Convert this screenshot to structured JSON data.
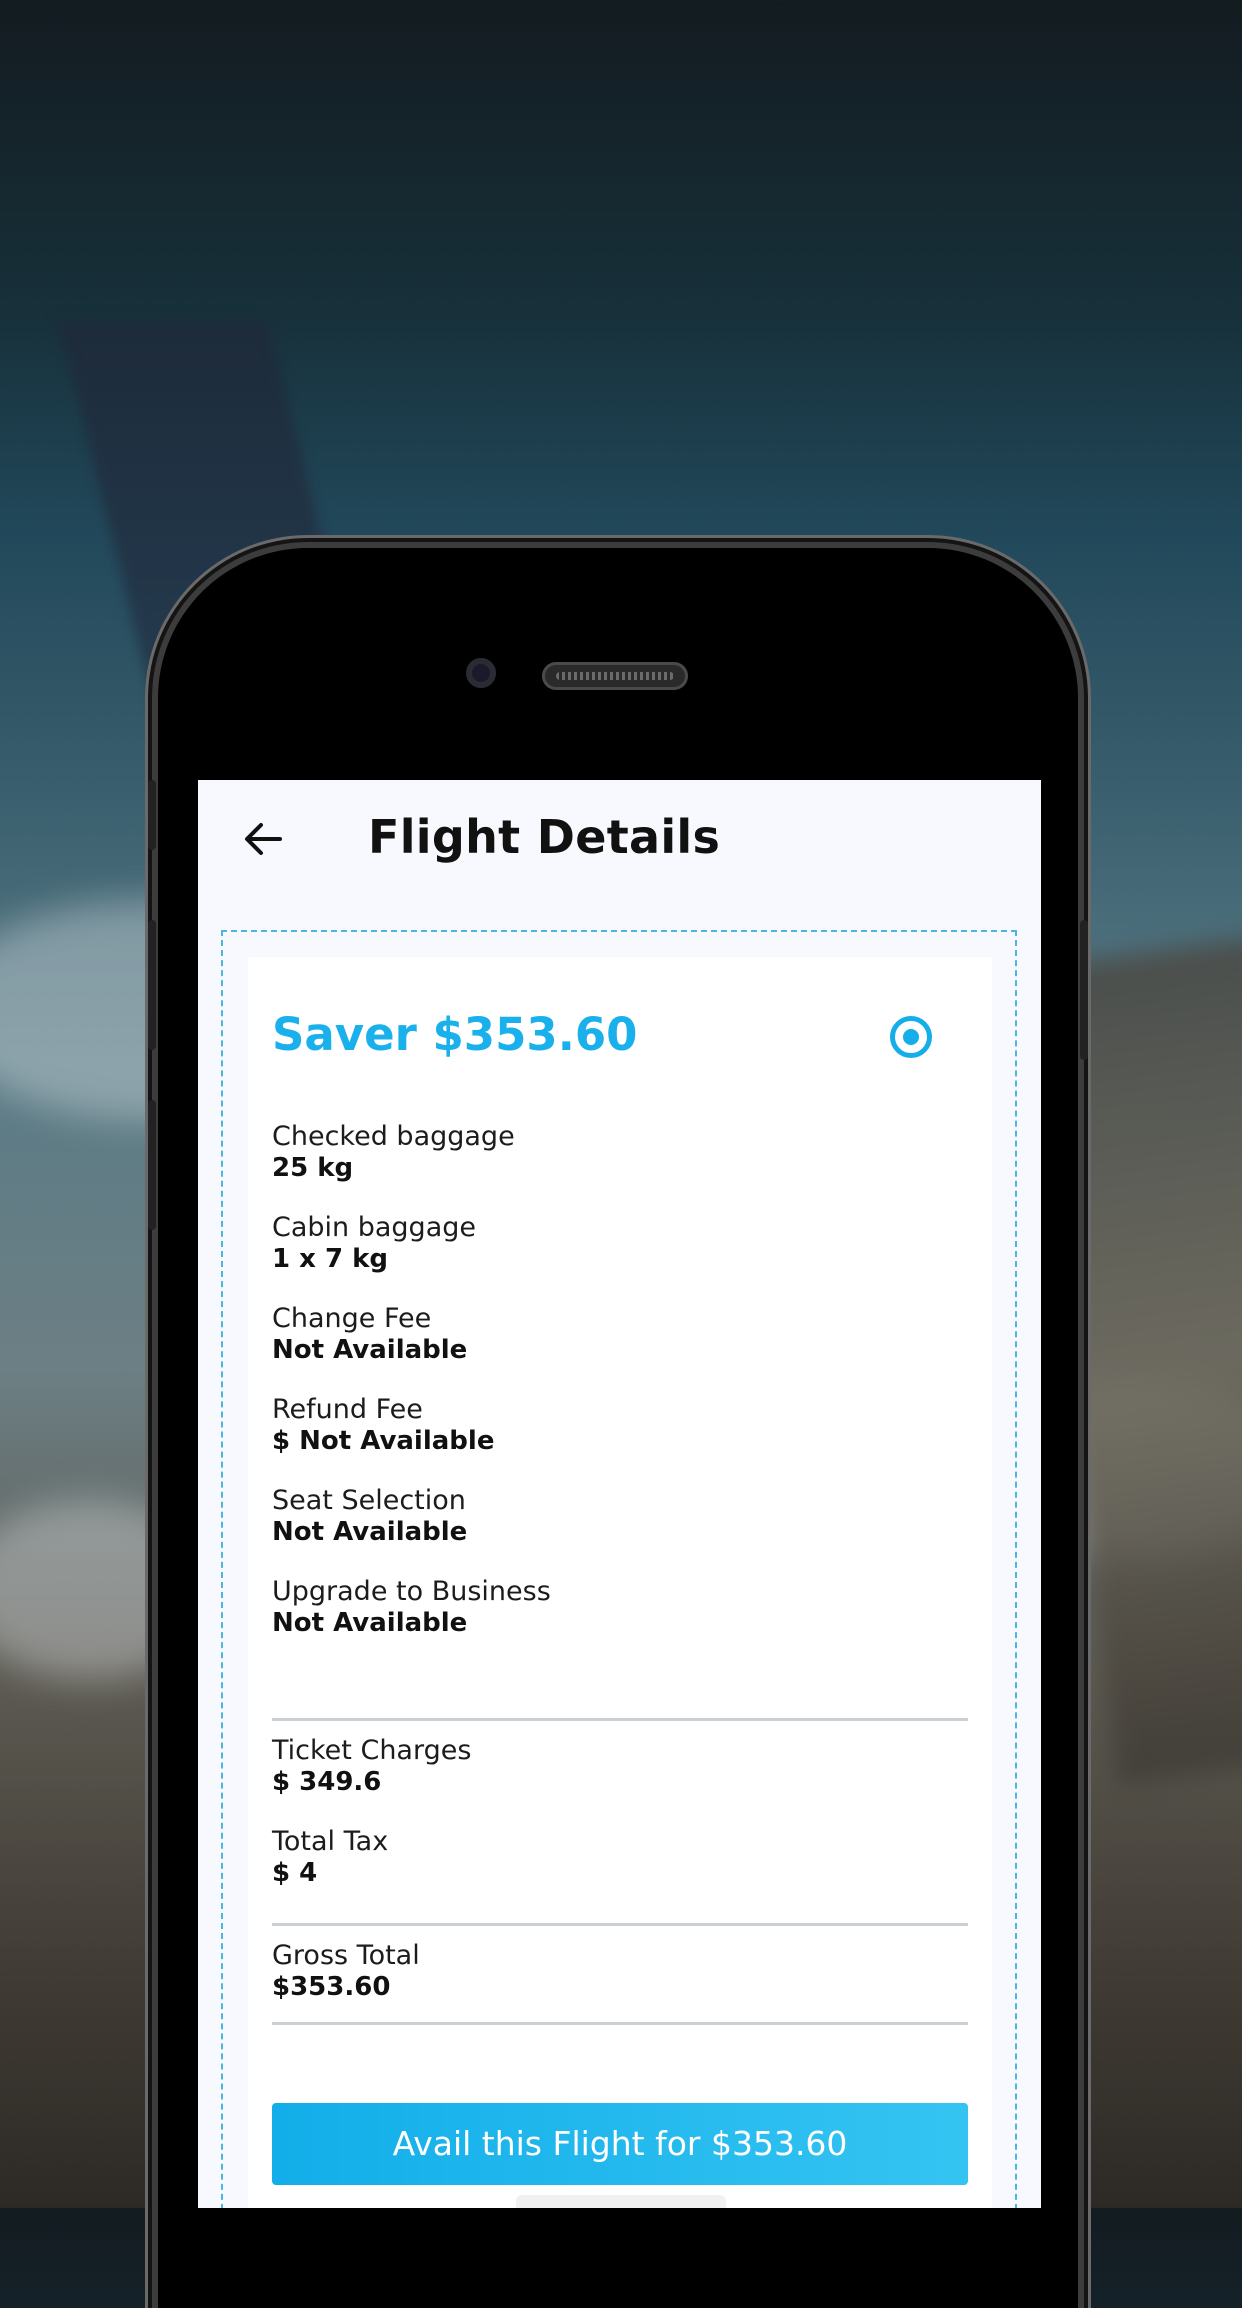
{
  "header": {
    "title": "Flight Details"
  },
  "fare": {
    "title": "Saver $353.60",
    "selected": true,
    "accent_color": "#1ab0ec"
  },
  "details": [
    {
      "label": "Checked baggage",
      "value": "25 kg"
    },
    {
      "label": "Cabin baggage",
      "value": "1 x 7 kg"
    },
    {
      "label": "Change Fee",
      "value": "Not Available"
    },
    {
      "label": "Refund Fee",
      "value": "$ Not Available"
    },
    {
      "label": "Seat Selection",
      "value": "Not Available"
    },
    {
      "label": "Upgrade to Business",
      "value": "Not Available"
    }
  ],
  "charges": [
    {
      "label": "Ticket Charges",
      "value": "$ 349.6"
    },
    {
      "label": "Total Tax",
      "value": "$ 4"
    }
  ],
  "total": {
    "label": "Gross Total",
    "value": "$353.60"
  },
  "cta": {
    "label": "Avail this Flight for $353.60"
  },
  "icons": {
    "back": "arrow-left-icon",
    "radio": "radio-selected-icon"
  }
}
